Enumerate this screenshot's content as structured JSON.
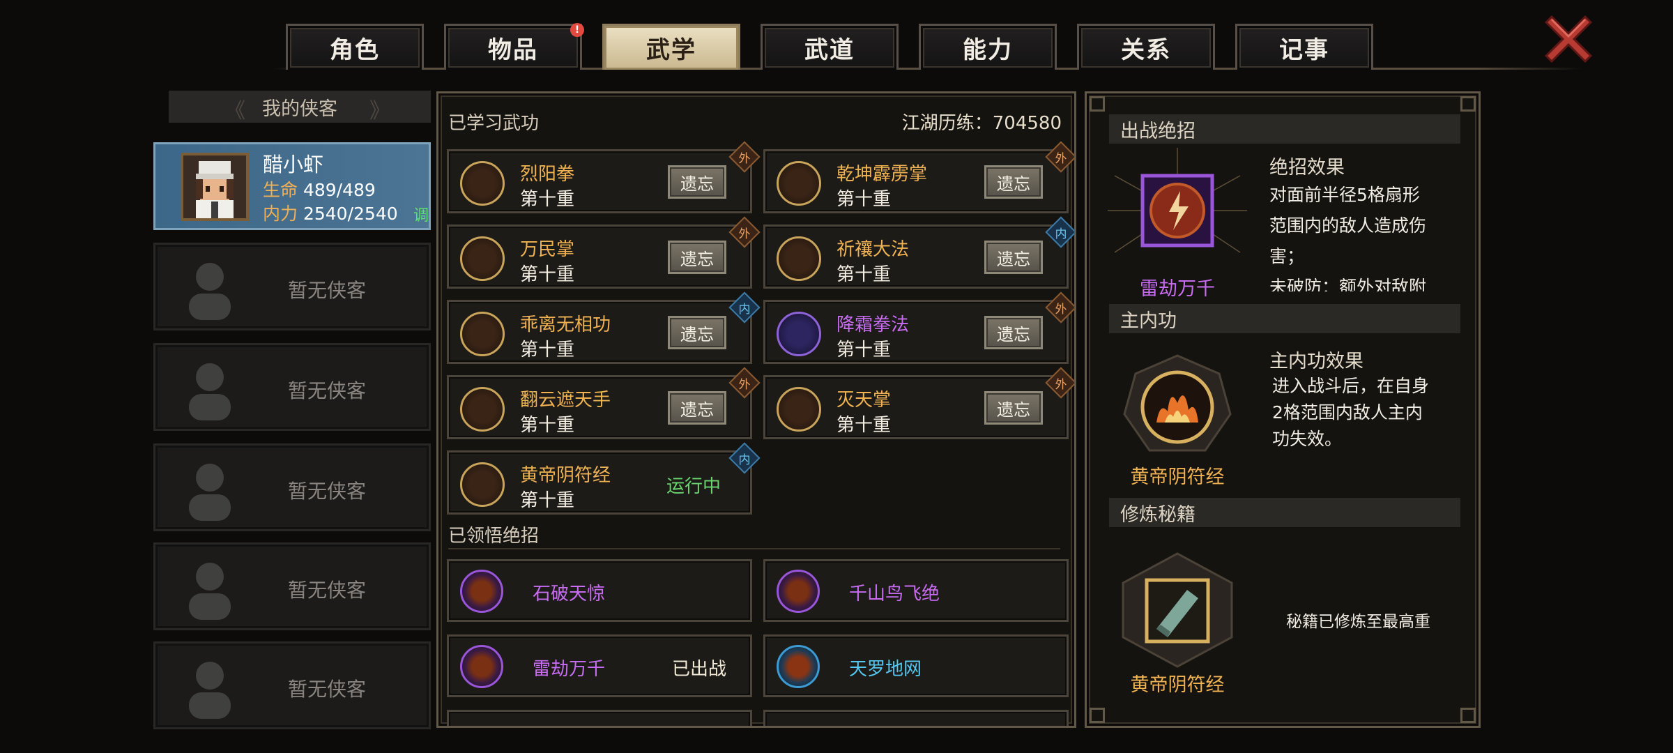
{
  "tabs": [
    {
      "label": "角色",
      "active": false,
      "badge": false
    },
    {
      "label": "物品",
      "active": false,
      "badge": true
    },
    {
      "label": "武学",
      "active": true,
      "badge": false
    },
    {
      "label": "武道",
      "active": false,
      "badge": false
    },
    {
      "label": "能力",
      "active": false,
      "badge": false
    },
    {
      "label": "关系",
      "active": false,
      "badge": false
    },
    {
      "label": "记事",
      "active": false,
      "badge": false
    }
  ],
  "badge_text": "!",
  "left": {
    "title": "我的侠客",
    "hero": {
      "name": "醋小虾",
      "hp_label": "生命",
      "hp_value": "489/489",
      "mp_label": "内力",
      "mp_value": "2540/2540",
      "adjust": "调"
    },
    "empty_label": "暂无侠客"
  },
  "middle": {
    "learned_title": "已学习武功",
    "exp_label": "江湖历练：704580",
    "forget_label": "遗忘",
    "running_label": "运行中",
    "skills": [
      {
        "name": "烈阳拳",
        "level": "第十重",
        "tag": "外",
        "tag_type": "wai",
        "color": "#f0b252",
        "state": "forget",
        "icon": "fist-flame-icon"
      },
      {
        "name": "乾坤霹雳掌",
        "level": "第十重",
        "tag": "外",
        "tag_type": "wai",
        "color": "#f0b252",
        "state": "forget",
        "icon": "lightning-palm-icon"
      },
      {
        "name": "万民掌",
        "level": "第十重",
        "tag": "外",
        "tag_type": "wai",
        "color": "#f0b252",
        "state": "forget",
        "icon": "flower-palm-icon"
      },
      {
        "name": "祈禳大法",
        "level": "第十重",
        "tag": "内",
        "tag_type": "nei",
        "color": "#f0b252",
        "state": "forget",
        "icon": "star-rite-icon"
      },
      {
        "name": "乖离无相功",
        "level": "第十重",
        "tag": "内",
        "tag_type": "nei",
        "color": "#f0b252",
        "state": "forget",
        "icon": "swirl-icon"
      },
      {
        "name": "降霜拳法",
        "level": "第十重",
        "tag": "外",
        "tag_type": "wai",
        "color": "#c86cf2",
        "state": "forget",
        "icon": "frost-fist-icon"
      },
      {
        "name": "翻云遮天手",
        "level": "第十重",
        "tag": "外",
        "tag_type": "wai",
        "color": "#f0b252",
        "state": "forget",
        "icon": "cloud-hand-icon"
      },
      {
        "name": "灭天掌",
        "level": "第十重",
        "tag": "外",
        "tag_type": "wai",
        "color": "#f0b252",
        "state": "forget",
        "icon": "palm-icon"
      },
      {
        "name": "黄帝阴符经",
        "level": "第十重",
        "tag": "内",
        "tag_type": "nei",
        "color": "#f0b252",
        "state": "running",
        "icon": "fire-ring-icon"
      }
    ],
    "ult_title": "已领悟绝招",
    "ults": [
      {
        "name": "石破天惊",
        "color": "#c86cf2",
        "status": "",
        "icon": "burst-icon"
      },
      {
        "name": "千山鸟飞绝",
        "color": "#c86cf2",
        "status": "",
        "icon": "mountain-icon"
      },
      {
        "name": "雷劫万千",
        "color": "#c86cf2",
        "status": "已出战",
        "icon": "thunder-icon"
      },
      {
        "name": "天罗地网",
        "color": "#55c7f0",
        "status": "",
        "icon": "net-icon"
      }
    ]
  },
  "right": {
    "sec1_title": "出战绝招",
    "sec1_effect_label": "绝招效果",
    "sec1_text1": "对面前半径5格扇形",
    "sec1_text2": "范围内的敌人造成伤",
    "sec1_text3": "害；",
    "sec1_text4": "未破防：额外对敌附",
    "sec1_caption": "雷劫万千",
    "sec2_title": "主内功",
    "sec2_effect_label": "主内功效果",
    "sec2_text1": "进入战斗后，在自身",
    "sec2_text2": "2格范围内敌人主内",
    "sec2_text3": "功失效。",
    "sec2_caption": "黄帝阴符经",
    "sec3_title": "修炼秘籍",
    "sec3_text": "秘籍已修炼至最高重",
    "sec3_caption": "黄帝阴符经"
  }
}
